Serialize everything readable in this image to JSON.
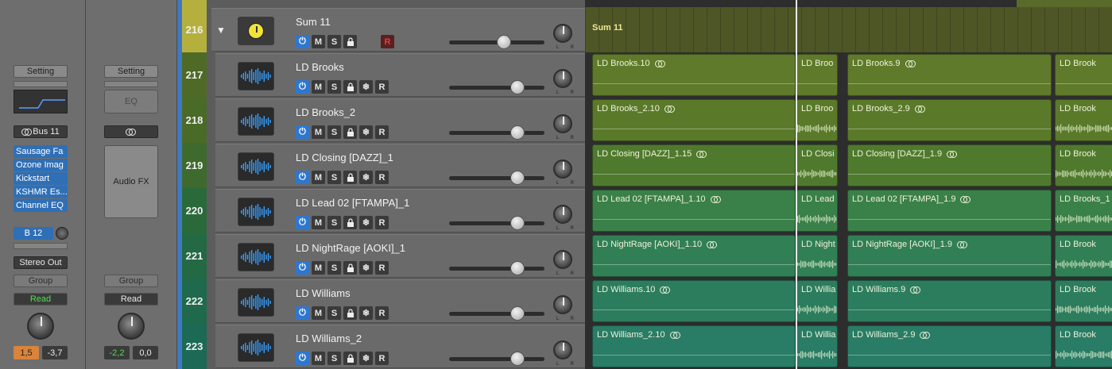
{
  "inspector": {
    "left_strip": {
      "setting": "Setting",
      "bus": "Bus 11",
      "plugins": [
        "Sausage Fa",
        "Ozone Imag",
        "Kickstart",
        "KSHMR Es...",
        "Channel EQ"
      ],
      "send": "B 12",
      "output": "Stereo Out",
      "group": "Group",
      "automation": "Read",
      "volume": "1,5",
      "peak": "-3,7"
    },
    "right_strip": {
      "setting": "Setting",
      "eq": "EQ",
      "audio_fx": "Audio FX",
      "group": "Group",
      "automation": "Read",
      "volume": "-2,2",
      "peak": "0,0"
    }
  },
  "tracks": [
    {
      "num": "216",
      "name": "Sum 11",
      "stack": true,
      "num_color": "#b5b03e",
      "region_color": "#6f7b2e"
    },
    {
      "num": "217",
      "name": "LD Brooks",
      "num_color": "#4f6a26",
      "region_color": "#5f7a2a"
    },
    {
      "num": "218",
      "name": "LD Brooks_2",
      "num_color": "#4a6a28",
      "region_color": "#5a7a2a"
    },
    {
      "num": "219",
      "name": "LD Closing [DAZZ]_1",
      "num_color": "#3f6a2e",
      "region_color": "#4f7a2e"
    },
    {
      "num": "220",
      "name": "LD Lead 02 [FTAMPA]_1",
      "num_color": "#2a6a3a",
      "region_color": "#3a8049"
    },
    {
      "num": "221",
      "name": "LD NightRage [AOKI]_1",
      "num_color": "#236a44",
      "region_color": "#317f55"
    },
    {
      "num": "222",
      "name": "LD Williams",
      "num_color": "#1f6a4c",
      "region_color": "#2c7d5e"
    },
    {
      "num": "223",
      "name": "LD Williams_2",
      "num_color": "#1c6a55",
      "region_color": "#297c66"
    }
  ],
  "buttons": {
    "mute": "M",
    "solo": "S",
    "record": "R",
    "pan_l": "L",
    "pan_r": "R"
  },
  "regions": [
    {
      "row": 0,
      "items": [
        {
          "label": "Sum 11"
        }
      ]
    },
    {
      "row": 1,
      "items": [
        {
          "label": "LD Brooks.10"
        },
        {
          "label": "LD Broo"
        },
        {
          "label": "LD Brooks.9"
        },
        {
          "label": "LD Brook"
        }
      ]
    },
    {
      "row": 2,
      "items": [
        {
          "label": "LD Brooks_2.10"
        },
        {
          "label": "LD Broo"
        },
        {
          "label": "LD Brooks_2.9"
        },
        {
          "label": "LD Brook"
        }
      ]
    },
    {
      "row": 3,
      "items": [
        {
          "label": "LD Closing [DAZZ]_1.15"
        },
        {
          "label": "LD Closi"
        },
        {
          "label": "LD Closing [DAZZ]_1.9"
        },
        {
          "label": "LD Brook"
        }
      ]
    },
    {
      "row": 4,
      "items": [
        {
          "label": "LD Lead 02 [FTAMPA]_1.10"
        },
        {
          "label": "LD Lead"
        },
        {
          "label": "LD Lead 02 [FTAMPA]_1.9"
        },
        {
          "label": "LD Brooks_1"
        }
      ]
    },
    {
      "row": 5,
      "items": [
        {
          "label": "LD NightRage [AOKI]_1.10"
        },
        {
          "label": "LD Night"
        },
        {
          "label": "LD NightRage [AOKI]_1.9"
        },
        {
          "label": "LD Brook"
        }
      ]
    },
    {
      "row": 6,
      "items": [
        {
          "label": "LD Williams.10"
        },
        {
          "label": "LD Willia"
        },
        {
          "label": "LD Williams.9"
        },
        {
          "label": "LD Brook"
        }
      ]
    },
    {
      "row": 7,
      "items": [
        {
          "label": "LD Williams_2.10"
        },
        {
          "label": "LD Willia"
        },
        {
          "label": "LD Williams_2.9"
        },
        {
          "label": "LD Brook"
        }
      ]
    }
  ]
}
